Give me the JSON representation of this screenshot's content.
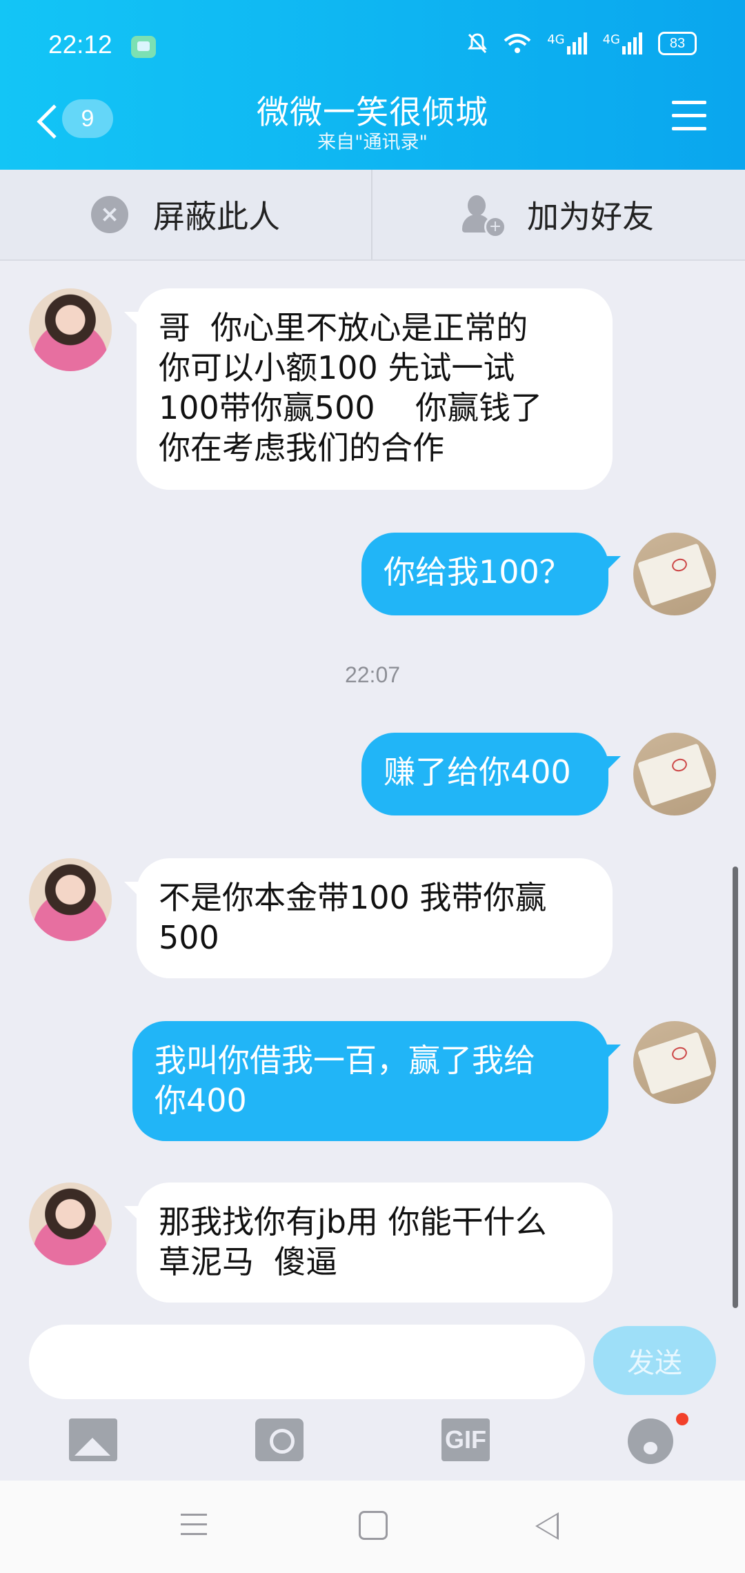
{
  "status_bar": {
    "time": "22:12",
    "network_1": "4G",
    "network_2": "4G",
    "battery": "83"
  },
  "header": {
    "unread_count": "9",
    "title": "微微一笑很倾城",
    "subtitle": "来自\"通讯录\""
  },
  "actions": {
    "block_label": "屏蔽此人",
    "add_friend_label": "加为好友"
  },
  "messages": [
    {
      "side": "left",
      "text": "哥  你心里不放心是正常的\n你可以小额100 先试一试\n100带你赢500    你赢钱了\n你在考虑我们的合作"
    },
    {
      "side": "right",
      "text": "你给我100？"
    },
    {
      "side": "right",
      "text": "赚了给你400"
    },
    {
      "side": "left",
      "text": "不是你本金带100 我带你赢\n500"
    },
    {
      "side": "right",
      "text": "我叫你借我一百，赢了我给\n你400"
    },
    {
      "side": "left",
      "text": "那我找你有jb用 你能干什么\n草泥马  傻逼"
    }
  ],
  "timestamp": "22:07",
  "composer": {
    "input_value": "",
    "send_label": "发送"
  },
  "toolbar": {
    "gif_label": "GIF"
  },
  "colors": {
    "header_start": "#13c5f6",
    "header_end": "#0aa6ee",
    "outgoing_bubble": "#21b5f7",
    "incoming_bubble": "#ffffff",
    "background": "#ecedf4"
  }
}
